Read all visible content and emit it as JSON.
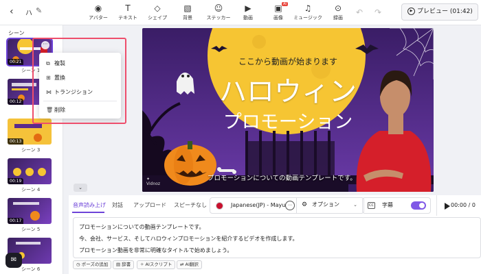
{
  "header": {
    "back_icon": "chevron-left-icon",
    "project_name": "ハ",
    "edit_icon": "pencil-icon",
    "tools": [
      {
        "label": "アバター",
        "icon": "person-icon"
      },
      {
        "label": "テキスト",
        "icon": "text-icon"
      },
      {
        "label": "シェイプ",
        "icon": "shapes-icon"
      },
      {
        "label": "背景",
        "icon": "background-icon"
      },
      {
        "label": "ステッカー",
        "icon": "sticker-icon"
      },
      {
        "label": "動画",
        "icon": "video-icon"
      },
      {
        "label": "画像",
        "icon": "image-icon",
        "badge": "AI"
      },
      {
        "label": "ミュージック",
        "icon": "music-icon"
      },
      {
        "label": "録画",
        "icon": "record-icon"
      }
    ],
    "preview_label": "プレビュー (01:42)"
  },
  "scenes": {
    "title": "シーン",
    "items": [
      {
        "label": "シーン 1",
        "duration": "00:21"
      },
      {
        "label": "シーン 2",
        "duration": "00:12"
      },
      {
        "label": "シーン 3",
        "duration": "00:13"
      },
      {
        "label": "シーン 4",
        "duration": "00:19"
      },
      {
        "label": "シーン 5",
        "duration": "00:17"
      },
      {
        "label": "シーン 6",
        "duration": ""
      }
    ]
  },
  "context_menu": {
    "items": [
      {
        "label": "複製",
        "icon": "copy-icon"
      },
      {
        "label": "置換",
        "icon": "replace-icon"
      },
      {
        "label": "トランジション",
        "icon": "transition-icon"
      },
      {
        "label": "削除",
        "icon": "trash-icon"
      }
    ]
  },
  "canvas": {
    "heading": "ここから動画が始まります",
    "title_main": "ハロウィン",
    "title_sub": "プロモーション",
    "caption": "プロモーションについての動画テンプレートです。",
    "logo": "Vidnoz"
  },
  "editor": {
    "tabs": [
      "音声読み上げ",
      "対話",
      "アップロード",
      "スピーチなし"
    ],
    "voice": "Japanese(JP) - Mayu",
    "option_label": "オプション",
    "subtitle_label": "字幕",
    "subtitle_on": true,
    "time": "00:00 / 0",
    "script_lines": [
      "プロモーションについての動画テンプレートです。",
      "今、会社、サービス、そしてハロウィンプロモーションを紹介するビデオを作成します。",
      "プロモーション動画を非常に明確なタイトルで始めましょう。"
    ],
    "chips": [
      "ポーズの追加",
      "辞書",
      "AIスクリプト",
      "AI翻訳"
    ]
  },
  "colors": {
    "accent": "#6c42d8",
    "highlight": "#ee4d6b",
    "halloween_purple": "#4a2a7a",
    "moon": "#f6c533"
  }
}
